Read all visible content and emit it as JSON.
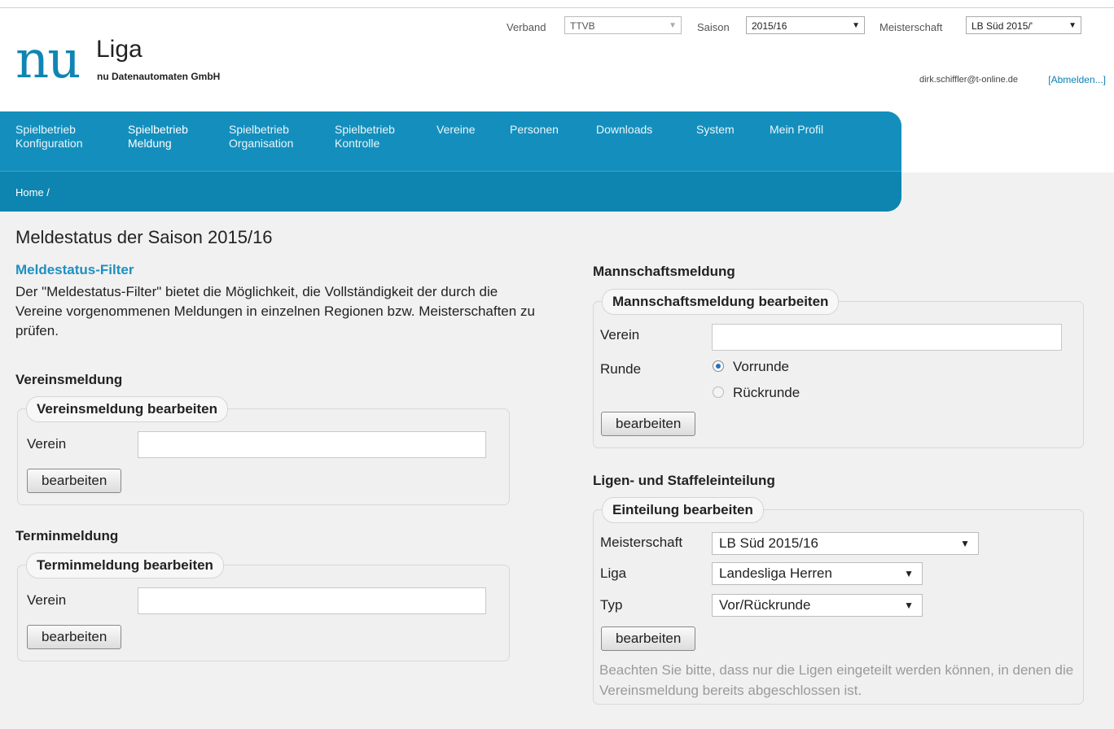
{
  "header": {
    "logo_nu": "nu",
    "logo_liga": "Liga",
    "logo_company": "nu Datenautomaten GmbH",
    "verband_label": "Verband",
    "verband_value": "TTVB",
    "saison_label": "Saison",
    "saison_value": "2015/16",
    "meisterschaft_label": "Meisterschaft",
    "meisterschaft_value": "LB Süd 2015/'",
    "user_email": "dirk.schiffler@t-online.de",
    "logout_label": "[Abmelden...]"
  },
  "nav": {
    "items": [
      {
        "line1": "Spielbetrieb",
        "line2": "Konfiguration"
      },
      {
        "line1": "Spielbetrieb",
        "line2": "Meldung"
      },
      {
        "line1": "Spielbetrieb",
        "line2": "Organisation"
      },
      {
        "line1": "Spielbetrieb",
        "line2": "Kontrolle"
      },
      {
        "line1": "Vereine",
        "line2": ""
      },
      {
        "line1": "Personen",
        "line2": ""
      },
      {
        "line1": "Downloads",
        "line2": ""
      },
      {
        "line1": "System",
        "line2": ""
      },
      {
        "line1": "Mein Profil",
        "line2": ""
      }
    ],
    "breadcrumb": "Home /"
  },
  "main": {
    "title": "Meldestatus der Saison 2015/16",
    "filter_link": "Meldestatus-Filter",
    "filter_desc": "Der \"Meldestatus-Filter\" bietet die Möglichkeit, die Vollständigkeit der durch die Vereine vorgenommenen Meldungen in einzelnen Regionen bzw. Meisterschaften zu prüfen."
  },
  "vereinsmeldung": {
    "heading": "Vereinsmeldung",
    "legend": "Vereinsmeldung bearbeiten",
    "verein_label": "Verein",
    "verein_value": "",
    "button": "bearbeiten"
  },
  "terminmeldung": {
    "heading": "Terminmeldung",
    "legend": "Terminmeldung bearbeiten",
    "verein_label": "Verein",
    "verein_value": "",
    "button": "bearbeiten"
  },
  "mannschaftsmeldung": {
    "heading": "Mannschaftsmeldung",
    "legend": "Mannschaftsmeldung bearbeiten",
    "verein_label": "Verein",
    "verein_value": "",
    "runde_label": "Runde",
    "option_vorrunde": "Vorrunde",
    "option_rueckrunde": "Rückrunde",
    "selected": "Vorrunde",
    "button": "bearbeiten"
  },
  "einteilung": {
    "heading": "Ligen- und Staffeleinteilung",
    "legend": "Einteilung bearbeiten",
    "meisterschaft_label": "Meisterschaft",
    "meisterschaft_value": "LB Süd 2015/16",
    "liga_label": "Liga",
    "liga_value": "Landesliga Herren",
    "typ_label": "Typ",
    "typ_value": "Vor/Rückrunde",
    "button": "bearbeiten",
    "note": "Beachten Sie bitte, dass nur die Ligen eingeteilt werden können, in denen die Vereinsmeldung bereits abgeschlossen ist."
  },
  "colors": {
    "brand_blue": "#0f8fbd",
    "link_blue": "#1e8fc0"
  }
}
